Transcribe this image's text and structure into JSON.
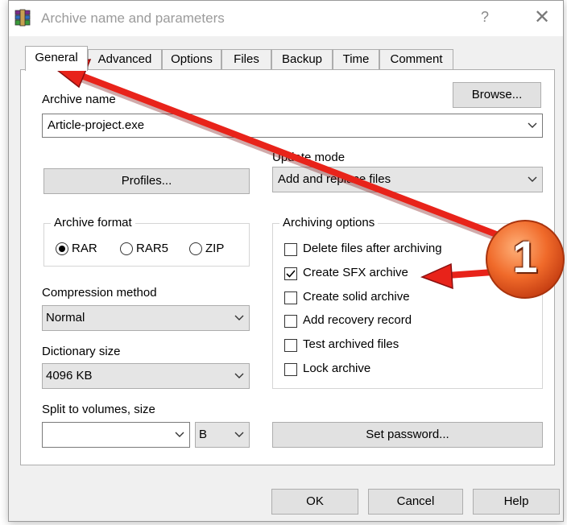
{
  "window": {
    "title": "Archive name and parameters",
    "help_glyph": "?",
    "close_glyph": "✕"
  },
  "tabs": [
    {
      "label": "General",
      "active": true
    },
    {
      "label": "Advanced"
    },
    {
      "label": "Options"
    },
    {
      "label": "Files"
    },
    {
      "label": "Backup"
    },
    {
      "label": "Time"
    },
    {
      "label": "Comment"
    }
  ],
  "general": {
    "archive_name_label": "Archive name",
    "browse_label": "Browse...",
    "archive_name_value": "Article-project.exe",
    "update_mode_label": "Update mode",
    "update_mode_value": "Add and replace files",
    "profiles_label": "Profiles...",
    "archive_format": {
      "title": "Archive format",
      "options": [
        {
          "label": "RAR",
          "selected": true
        },
        {
          "label": "RAR5",
          "selected": false
        },
        {
          "label": "ZIP",
          "selected": false
        }
      ]
    },
    "archiving_options": {
      "title": "Archiving options",
      "items": [
        {
          "label": "Delete files after archiving",
          "checked": false
        },
        {
          "label": "Create SFX archive",
          "checked": true
        },
        {
          "label": "Create solid archive",
          "checked": false
        },
        {
          "label": "Add recovery record",
          "checked": false
        },
        {
          "label": "Test archived files",
          "checked": false
        },
        {
          "label": "Lock archive",
          "checked": false
        }
      ]
    },
    "compression_method_label": "Compression method",
    "compression_method_value": "Normal",
    "dictionary_size_label": "Dictionary size",
    "dictionary_size_value": "4096 KB",
    "split_label": "Split to volumes, size",
    "split_value": "",
    "split_unit": "B",
    "set_password_label": "Set password..."
  },
  "footer": {
    "ok": "OK",
    "cancel": "Cancel",
    "help": "Help"
  },
  "annotation": {
    "badge": "1",
    "arrow_color": "#e8231a",
    "badge_color": "#e8501a"
  }
}
